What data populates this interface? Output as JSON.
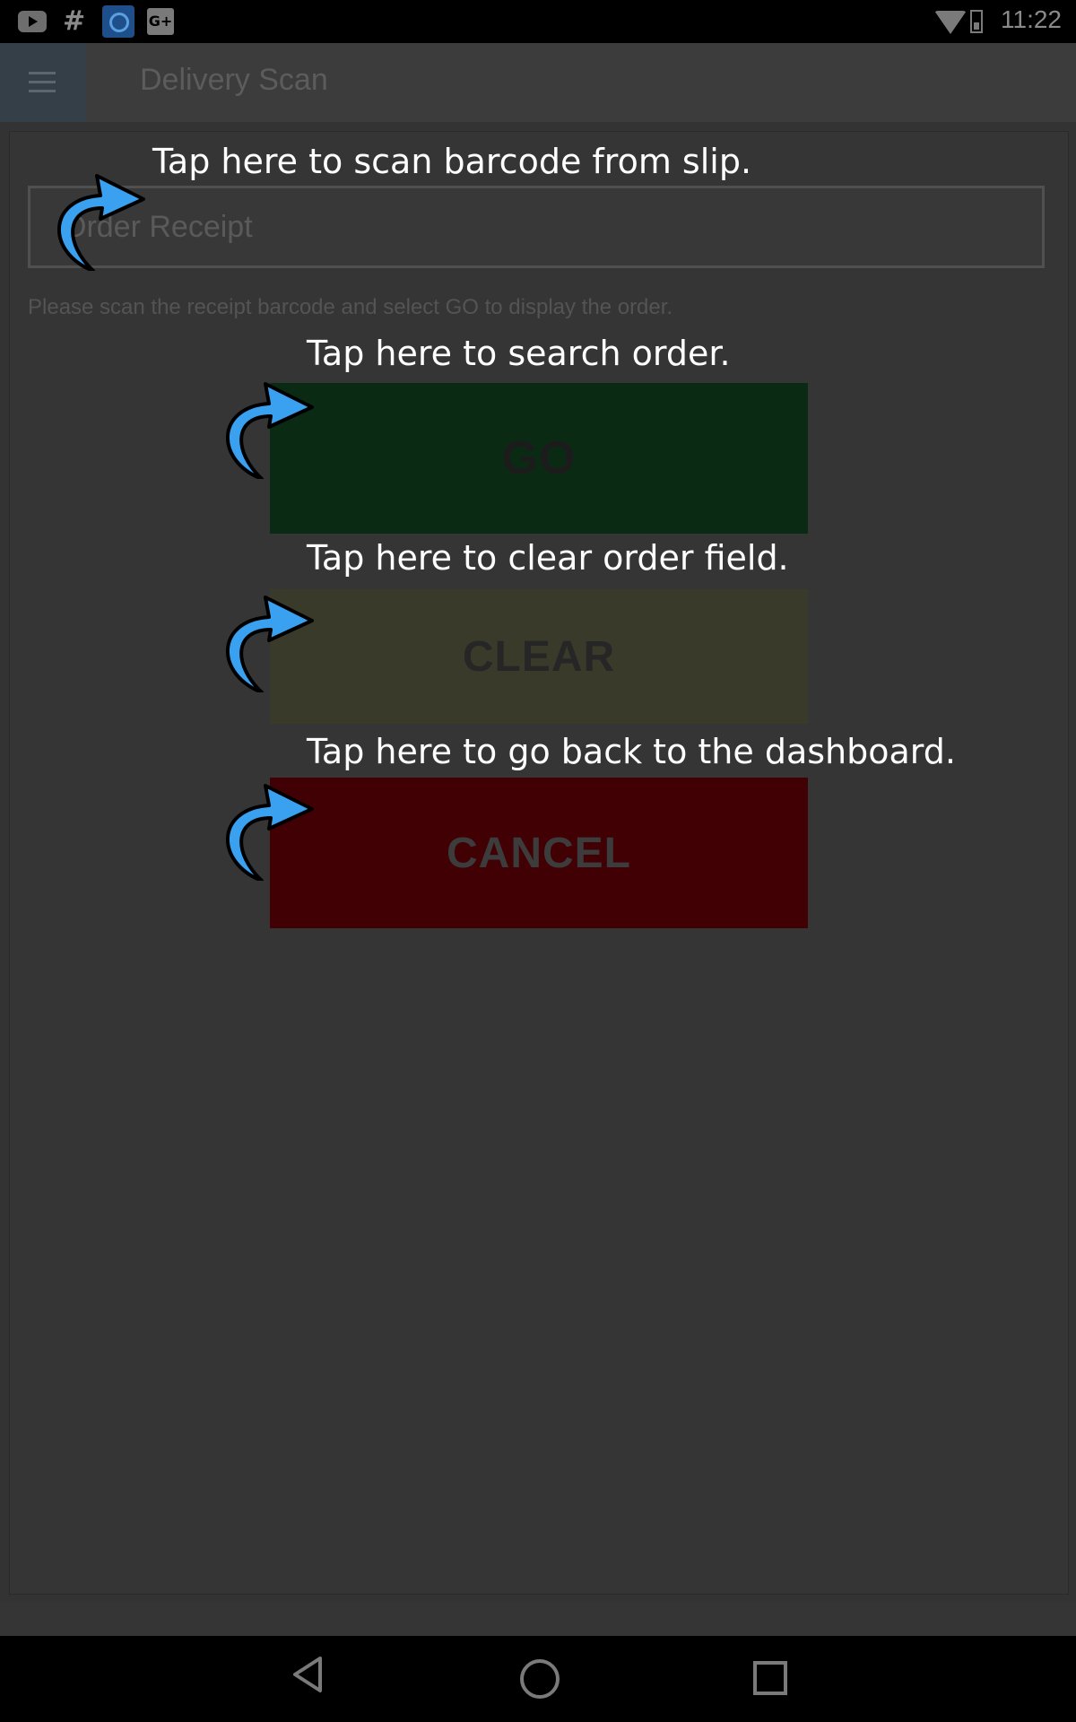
{
  "status_bar": {
    "time": "11:22",
    "left_icons": [
      "youtube-icon",
      "hash-icon",
      "app-icon",
      "google-plus-icon"
    ],
    "right_icons": [
      "wifi-icon",
      "battery-icon"
    ]
  },
  "app_bar": {
    "title": "Delivery Scan",
    "menu_icon": "hamburger-menu-icon"
  },
  "form": {
    "order_receipt_placeholder": "Order Receipt",
    "helper_text": "Please scan the receipt barcode and select GO to display the order."
  },
  "buttons": {
    "go": "GO",
    "clear": "CLEAR",
    "cancel": "CANCEL"
  },
  "tips": {
    "scan": "Tap here to scan barcode from slip.",
    "go": "Tap here to search order.",
    "clear": "Tap here to clear order field.",
    "cancel": "Tap here to go back to the dashboard."
  },
  "colors": {
    "go_bg": "#0b2a14",
    "clear_bg": "#3a3a2a",
    "cancel_bg": "#410004",
    "arrow": "#3aa0f0",
    "overlay_text": "#ffffff"
  },
  "nav_bar": {
    "icons": [
      "back-icon",
      "home-icon",
      "recent-apps-icon"
    ]
  }
}
